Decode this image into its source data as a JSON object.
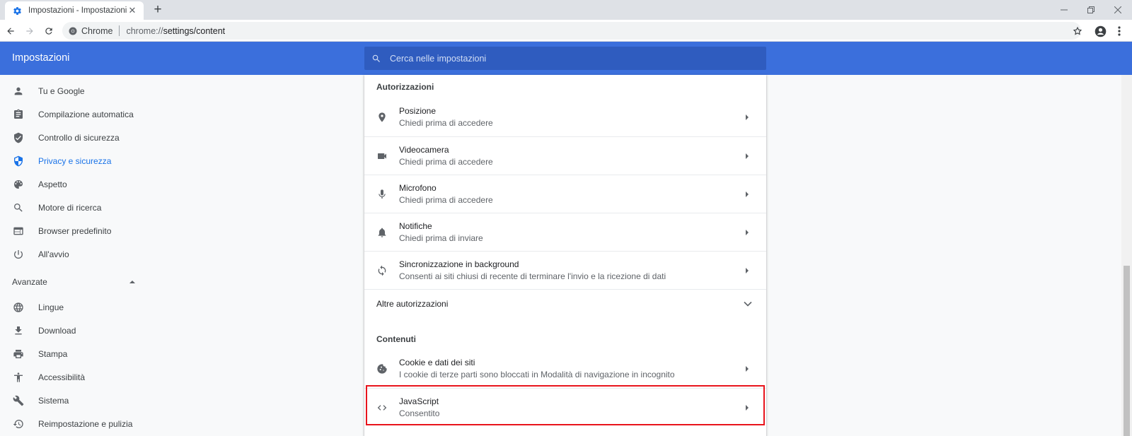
{
  "browser": {
    "tab_title": "Impostazioni - Impostazioni sito",
    "chip_label": "Chrome",
    "url_scheme": "chrome://",
    "url_rest": "settings/content"
  },
  "settings": {
    "title": "Impostazioni",
    "search_placeholder": "Cerca nelle impostazioni"
  },
  "sidebar": {
    "items": [
      {
        "label": "Tu e Google",
        "icon": "person-icon"
      },
      {
        "label": "Compilazione automatica",
        "icon": "clipboard-icon"
      },
      {
        "label": "Controllo di sicurezza",
        "icon": "shield-icon"
      },
      {
        "label": "Privacy e sicurezza",
        "icon": "shield-lock-icon",
        "active": true
      },
      {
        "label": "Aspetto",
        "icon": "palette-icon"
      },
      {
        "label": "Motore di ricerca",
        "icon": "search-icon"
      },
      {
        "label": "Browser predefinito",
        "icon": "browser-icon"
      },
      {
        "label": "All'avvio",
        "icon": "power-icon"
      }
    ],
    "advanced_label": "Avanzate",
    "advanced_items": [
      {
        "label": "Lingue",
        "icon": "globe-icon"
      },
      {
        "label": "Download",
        "icon": "download-icon"
      },
      {
        "label": "Stampa",
        "icon": "print-icon"
      },
      {
        "label": "Accessibilità",
        "icon": "accessibility-icon"
      },
      {
        "label": "Sistema",
        "icon": "wrench-icon"
      },
      {
        "label": "Reimpostazione e pulizia",
        "icon": "history-icon"
      }
    ]
  },
  "main": {
    "permissions_heading": "Autorizzazioni",
    "permissions": [
      {
        "title": "Posizione",
        "subtitle": "Chiedi prima di accedere",
        "icon": "location-icon"
      },
      {
        "title": "Videocamera",
        "subtitle": "Chiedi prima di accedere",
        "icon": "videocam-icon"
      },
      {
        "title": "Microfono",
        "subtitle": "Chiedi prima di accedere",
        "icon": "mic-icon"
      },
      {
        "title": "Notifiche",
        "subtitle": "Chiedi prima di inviare",
        "icon": "bell-icon"
      },
      {
        "title": "Sincronizzazione in background",
        "subtitle": "Consenti ai siti chiusi di recente di terminare l'invio e la ricezione di dati",
        "icon": "sync-icon"
      }
    ],
    "more_permissions": "Altre autorizzazioni",
    "content_heading": "Contenuti",
    "content": [
      {
        "title": "Cookie e dati dei siti",
        "subtitle": "I cookie di terze parti sono bloccati in Modalità di navigazione in incognito",
        "icon": "cookie-icon"
      },
      {
        "title": "JavaScript",
        "subtitle": "Consentito",
        "icon": "code-icon"
      }
    ]
  },
  "colors": {
    "header": "#3b6fdc",
    "active_nav": "#1a73e8",
    "highlight": "#e8141c"
  }
}
